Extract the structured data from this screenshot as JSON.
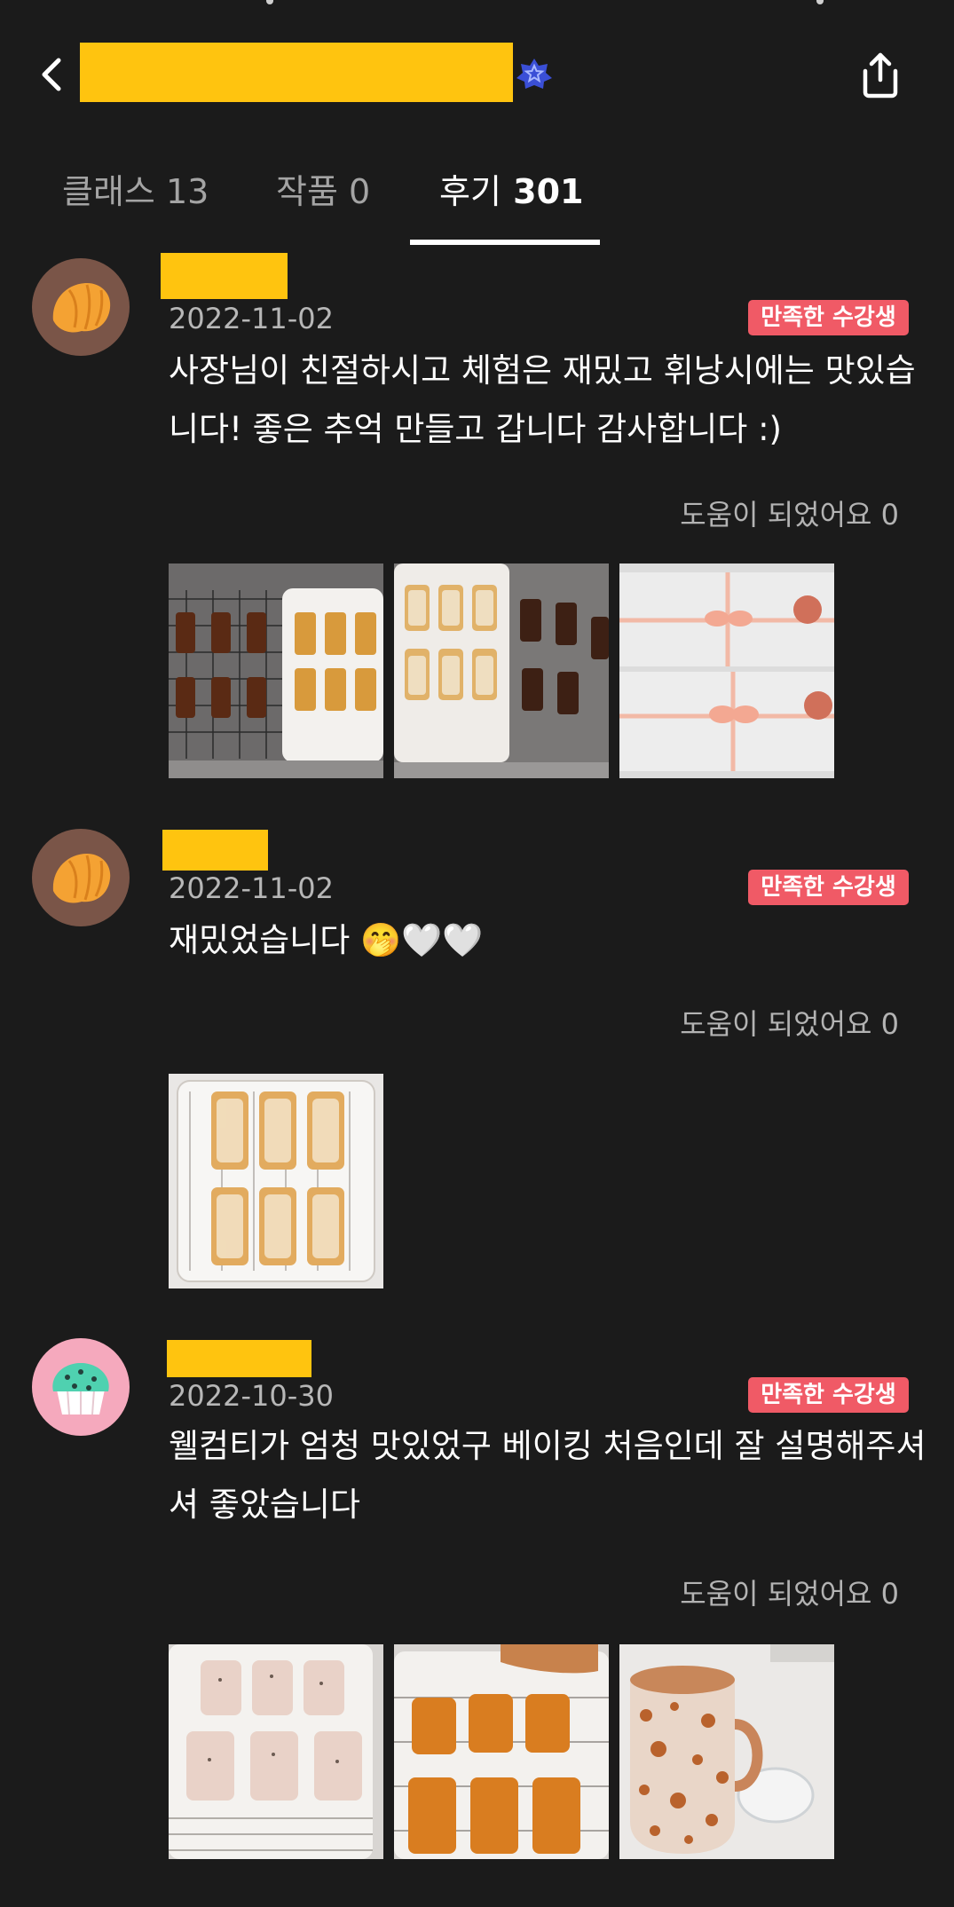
{
  "header": {
    "title": "",
    "back_icon": "chevron-left-icon",
    "verified_icon": "verified-badge-icon",
    "share_icon": "share-icon"
  },
  "tabs": [
    {
      "label": "클래스",
      "count": "13"
    },
    {
      "label": "작품",
      "count": "0"
    },
    {
      "label": "후기",
      "count": "301"
    }
  ],
  "reviews": [
    {
      "avatar": "croissant-avatar",
      "date": "2022-11-02",
      "badge": "만족한 수강생",
      "text": "사장님이 친절하시고 체험은 재밌고 휘낭시에는 맛있습니다! 좋은 추억 만들고 갑니다 감사합니다 :)",
      "helpful": "도움이 되었어요 0",
      "photos": [
        "financiers-on-rack-photo",
        "glazed-financiers-photo",
        "gift-boxes-photo"
      ]
    },
    {
      "avatar": "croissant-avatar",
      "date": "2022-11-02",
      "badge": "만족한 수강생",
      "text": "재밌었습니다 🤭🤍🤍",
      "helpful": "도움이 되었어요 0",
      "photos": [
        "glazed-financiers-tray-photo"
      ]
    },
    {
      "avatar": "cupcake-avatar",
      "date": "2022-10-30",
      "badge": "만족한 수강생",
      "text": "웰컴티가 엄청 맛있었구 베이킹 처음인데 잘 설명해주셔셔 좋았습니다",
      "helpful": "도움이 되었어요 0",
      "photos": [
        "iced-financiers-photo",
        "baked-financiers-photo",
        "speckled-mug-photo"
      ]
    }
  ],
  "colors": {
    "background": "#1b1b1b",
    "badge": "#f05a66",
    "redaction": "#ffc40f",
    "muted_text": "#b3b3b3"
  }
}
